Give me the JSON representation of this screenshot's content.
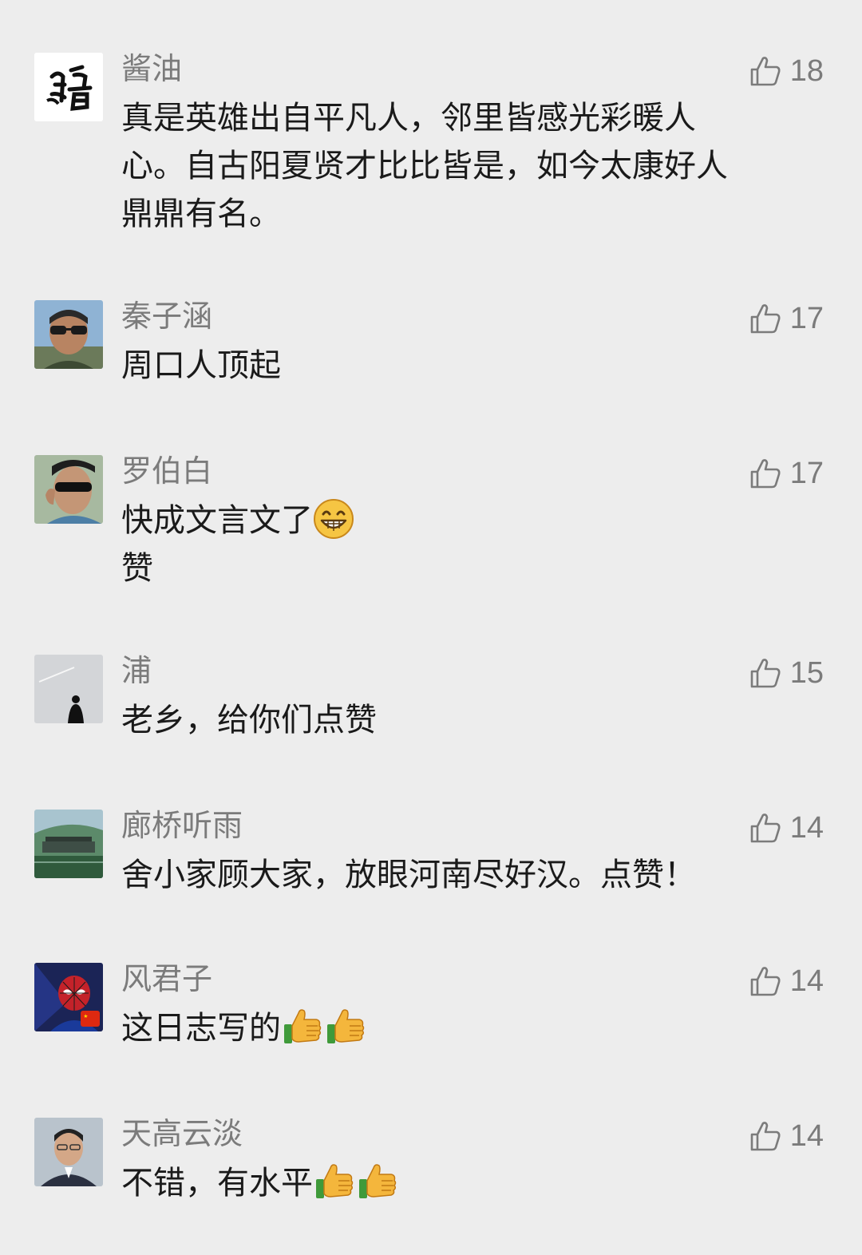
{
  "comments": [
    {
      "name": "酱油",
      "likes": "18",
      "avatar_icon": "calligraphy-avatar",
      "lines": [
        "真是英雄出自平凡人，邻里皆感光彩暖人",
        "心。自古阳夏贤才比比皆是，如今太康好人",
        "鼎鼎有名。"
      ]
    },
    {
      "name": "秦子涵",
      "likes": "17",
      "avatar_icon": "man-sunglasses-avatar",
      "lines": [
        "周口人顶起"
      ]
    },
    {
      "name": "罗伯白",
      "likes": "17",
      "avatar_icon": "man-cap-sunglasses-avatar",
      "lines": [
        "快成文言文了",
        "赞"
      ],
      "emoji": "grin-emoji"
    },
    {
      "name": "浦",
      "likes": "15",
      "avatar_icon": "silhouette-sky-avatar",
      "lines": [
        "老乡，给你们点赞"
      ]
    },
    {
      "name": "廊桥听雨",
      "likes": "14",
      "avatar_icon": "landscape-avatar",
      "lines": [
        "舍小家顾大家，放眼河南尽好汉。点赞！"
      ]
    },
    {
      "name": "风君子",
      "likes": "14",
      "avatar_icon": "spiderman-avatar",
      "lines": [
        "这日志写的"
      ],
      "emoji": "thumbs-up-emoji"
    },
    {
      "name": "天高云淡",
      "likes": "14",
      "avatar_icon": "man-portrait-avatar",
      "lines": [
        "不错，有水平"
      ],
      "emoji": "thumbs-up-emoji"
    }
  ],
  "colors": {
    "background": "#ededed",
    "name": "#7b7b7b",
    "text": "#1a1a1a"
  }
}
